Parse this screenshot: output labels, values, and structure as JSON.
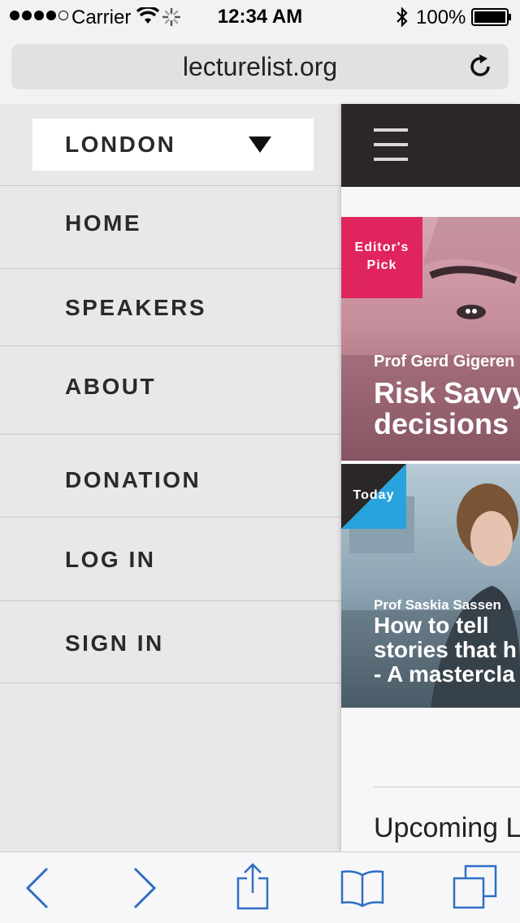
{
  "status_bar": {
    "carrier": "Carrier",
    "time": "12:34 AM",
    "battery": "100%"
  },
  "browser": {
    "url": "lecturelist.org"
  },
  "drawer": {
    "city": "LONDON",
    "menu": [
      {
        "label": "HOME"
      },
      {
        "label": "SPEAKERS"
      },
      {
        "label": "ABOUT"
      },
      {
        "label": "DONATION"
      },
      {
        "label": "LOG IN"
      },
      {
        "label": "SIGN IN"
      }
    ]
  },
  "content": {
    "cards": [
      {
        "badge": "Editor's Pick",
        "badge_color": "#e0245e",
        "speaker": "Prof Gerd Gigeren",
        "title_lines": [
          "Risk Savvy",
          "decisions"
        ]
      },
      {
        "badge": "Today",
        "badge_color": "#29a3dc",
        "speaker": "Prof Saskia Sassen",
        "title_lines": [
          "How to tell",
          "stories that h",
          "- A mastercla"
        ]
      }
    ],
    "section_heading": "Upcoming L"
  },
  "colors": {
    "topbar": "#2b2727",
    "drawer_bg": "#e8e8ea",
    "toolbar_icon": "#2f6fc4"
  }
}
